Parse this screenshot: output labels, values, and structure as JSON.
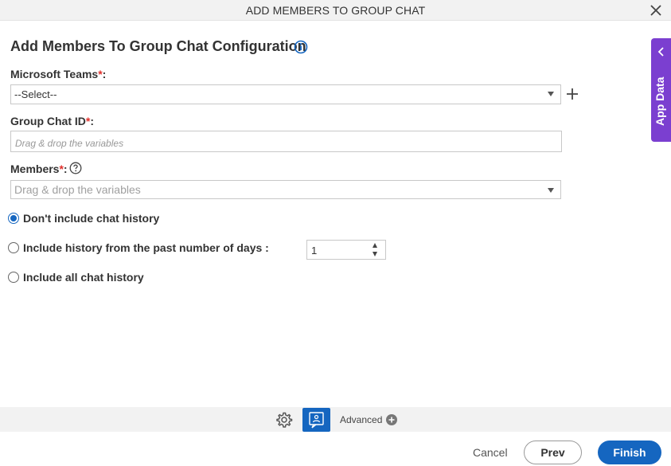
{
  "window": {
    "title": "ADD MEMBERS TO GROUP CHAT"
  },
  "heading": "Add Members To Group Chat Configuration",
  "fields": {
    "teams": {
      "label": "Microsoft Teams",
      "required": "*",
      "colon": ":",
      "value": "--Select--"
    },
    "group_chat_id": {
      "label": "Group Chat ID",
      "required": "*",
      "colon": ":",
      "placeholder": "Drag & drop the variables"
    },
    "members": {
      "label": "Members",
      "required": "*",
      "colon": ":",
      "placeholder": "Drag & drop the variables"
    }
  },
  "history_options": {
    "none": "Don't include chat history",
    "days": "Include history from the past number of days :",
    "all": "Include all chat history",
    "days_value": "1"
  },
  "side_tab": {
    "label": "App Data"
  },
  "toolbar": {
    "advanced": "Advanced"
  },
  "footer": {
    "cancel": "Cancel",
    "prev": "Prev",
    "finish": "Finish"
  },
  "colors": {
    "accent": "#1566c0",
    "side_tab": "#7b3fd0",
    "required": "#e0302c"
  }
}
